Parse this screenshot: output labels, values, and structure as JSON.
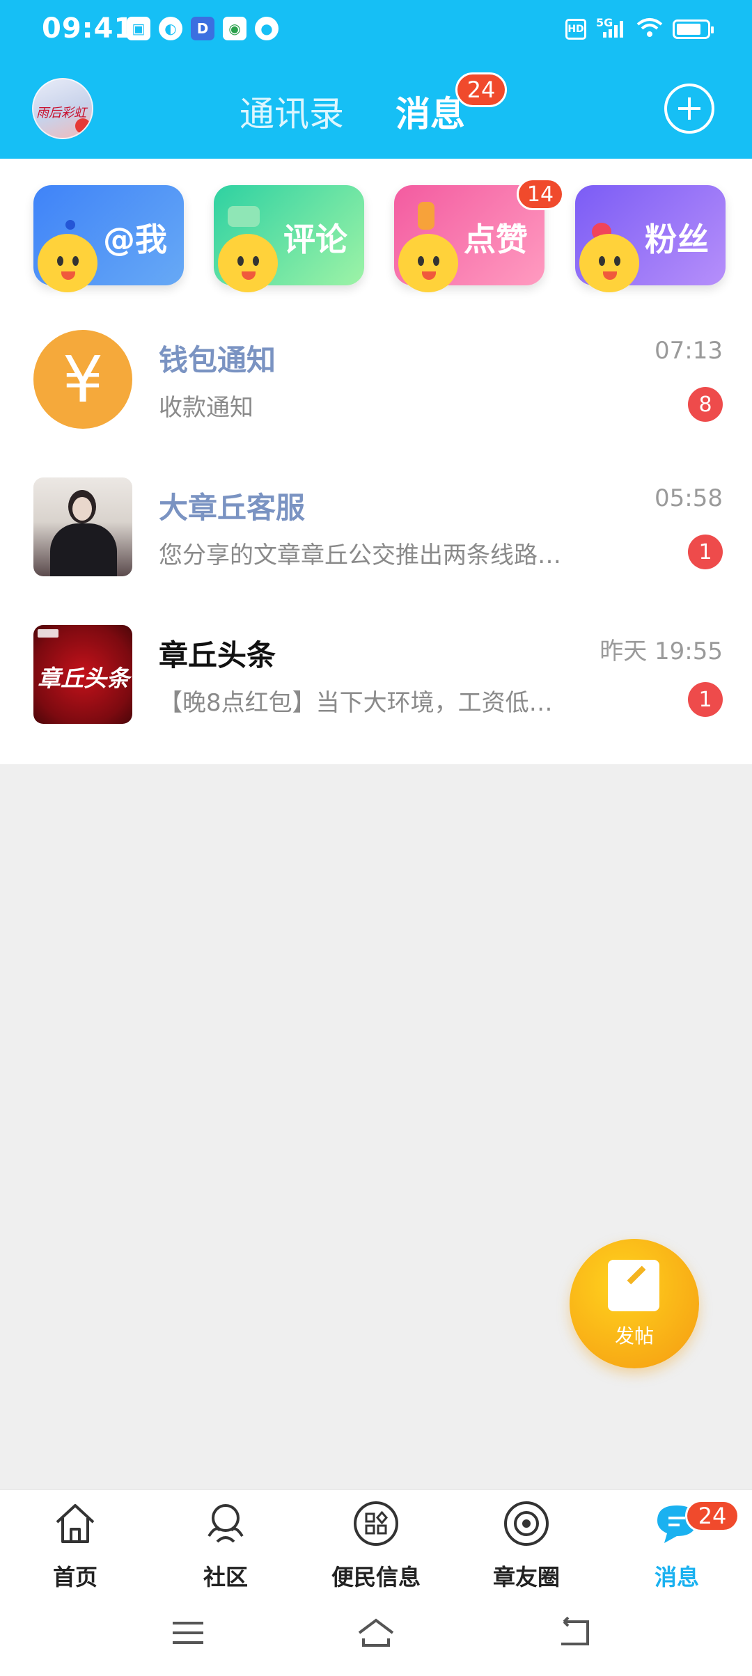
{
  "status_bar": {
    "time": "09:41",
    "hd": "HD",
    "network": "5G",
    "app_icons": [
      "gallery-icon",
      "browser-icon",
      "d-app-icon",
      "bank-app-icon",
      "chat-bubble-icon"
    ]
  },
  "header": {
    "tabs": [
      {
        "label": "通讯录",
        "active": false
      },
      {
        "label": "消息",
        "active": true
      }
    ],
    "messages_badge": "24",
    "add_icon": "plus-circle-icon",
    "avatar_text": "雨后彩虹"
  },
  "quick_cards": [
    {
      "label": "@我",
      "icon": "smiley-icon",
      "color_from": "#3f83f8",
      "color_to": "#67a9f5"
    },
    {
      "label": "评论",
      "icon": "smiley-icon",
      "color_from": "#2ed1a2",
      "color_to": "#9ef3a6"
    },
    {
      "label": "点赞",
      "icon": "smiley-icon",
      "color_from": "#f35ba0",
      "color_to": "#ff9bc0",
      "badge": "14"
    },
    {
      "label": "粉丝",
      "icon": "smiley-icon",
      "color_from": "#7b5cf5",
      "color_to": "#b68ffa"
    }
  ],
  "messages": [
    {
      "title": "钱包通知",
      "subtitle": "收款通知",
      "time": "07:13",
      "badge": "8",
      "icon": "yen-icon",
      "icon_glyph": "¥"
    },
    {
      "title": "大章丘客服",
      "subtitle": "您分享的文章章丘公交推出两条线路…",
      "time": "05:58",
      "badge": "1",
      "icon": "profile-photo-icon"
    },
    {
      "title": "章丘头条",
      "subtitle": "【晚8点红包】当下大环境，工资低…",
      "time": "昨天 19:55",
      "badge": "1",
      "icon": "news-logo-icon",
      "icon_text": "章丘头条"
    }
  ],
  "fab": {
    "label": "发帖",
    "icon": "edit-icon"
  },
  "bottom_nav": [
    {
      "label": "首页",
      "icon": "home-icon",
      "active": false
    },
    {
      "label": "社区",
      "icon": "community-icon",
      "active": false
    },
    {
      "label": "便民信息",
      "icon": "grid-services-icon",
      "active": false
    },
    {
      "label": "章友圈",
      "icon": "circle-camera-icon",
      "active": false
    },
    {
      "label": "消息",
      "icon": "message-bubble-icon",
      "active": true,
      "badge": "24"
    }
  ],
  "colors": {
    "header_bg": "#16bff5",
    "accent": "#1ab1f0",
    "badge": "#f04a2c",
    "wallet_icon": "#f5a93b",
    "title_blue": "#7a93c2"
  }
}
